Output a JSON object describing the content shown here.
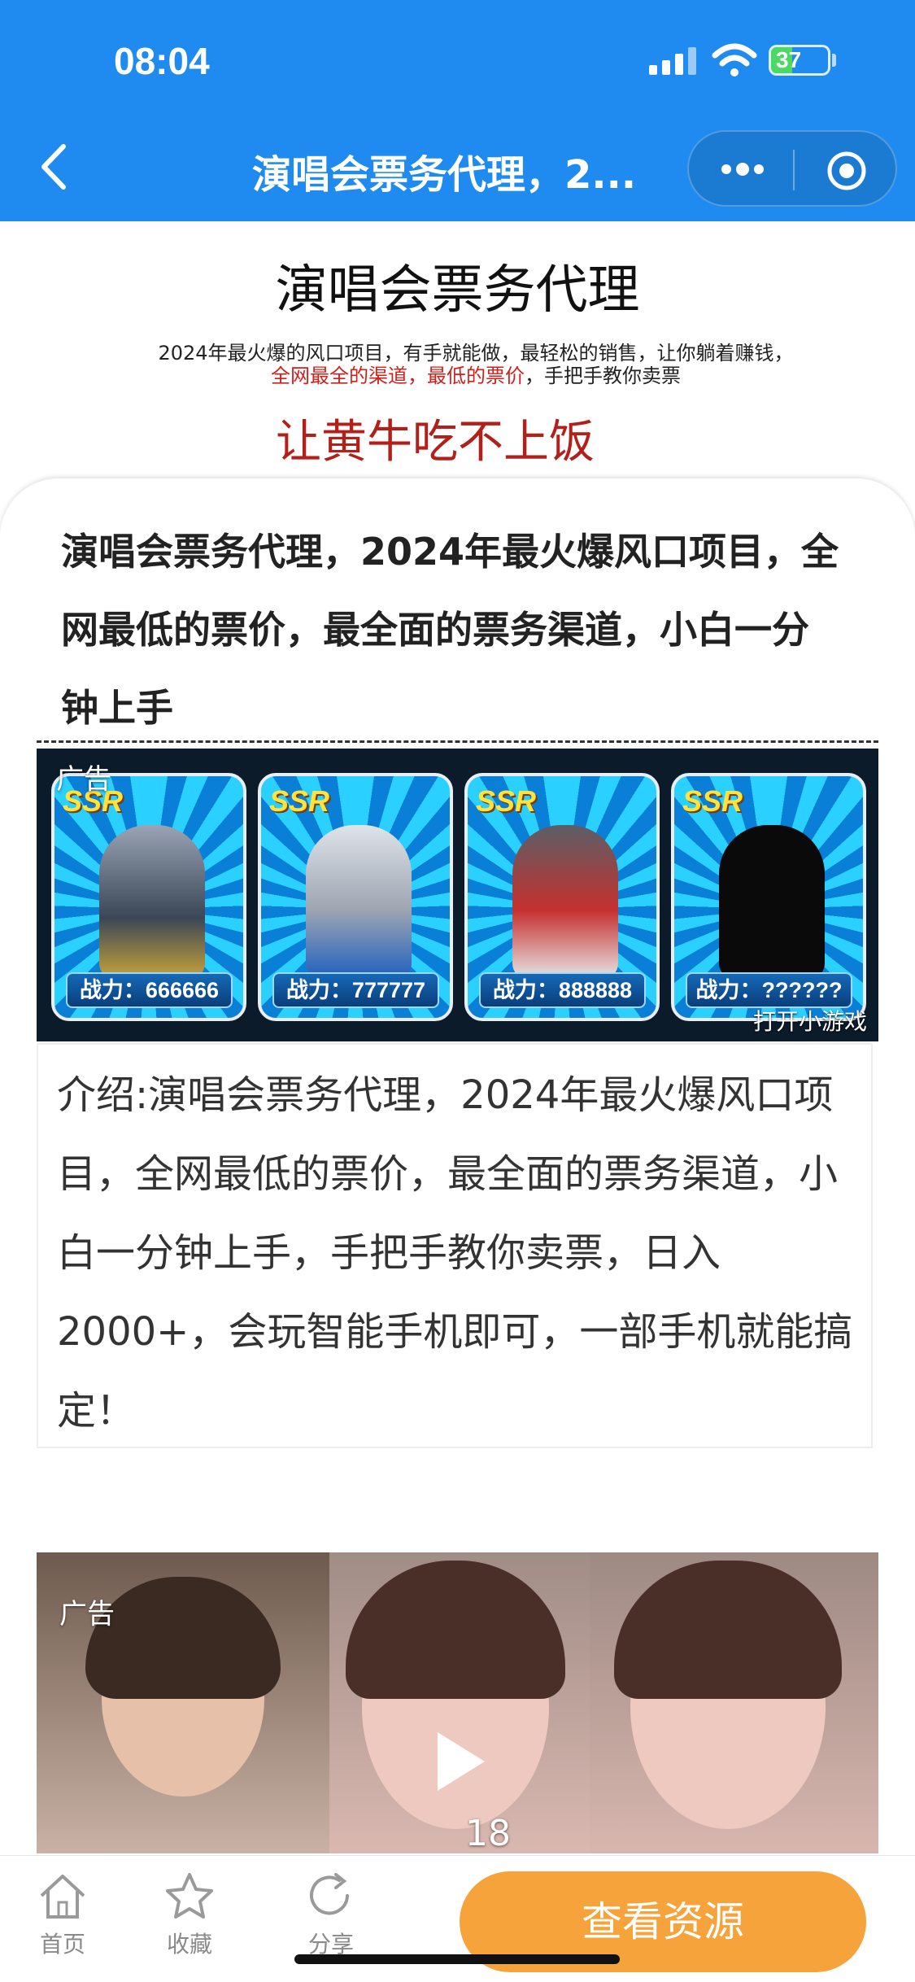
{
  "status_bar": {
    "time": "08:04",
    "battery": "37",
    "battery_level": 0.37
  },
  "nav": {
    "title": "演唱会票务代理，2...",
    "back_icon": "chevron-left-icon",
    "more_icon": "more-dots-icon",
    "close_icon": "target-circle-icon"
  },
  "poster": {
    "title": "演唱会票务代理",
    "subtitle_part1": "2024年最火爆的风口项目，有手就能做，最轻松的销售，让你躺着赚钱，",
    "subtitle_red": "全网最全的渠道，最低的票价",
    "subtitle_part3": "，手把手教你卖票",
    "red_slogan": "让黄牛吃不上饭"
  },
  "article": {
    "title": "演唱会票务代理，2024年最火爆风口项目，全网最低的票价，最全面的票务渠道，小白一分钟上手"
  },
  "game_ad": {
    "tag": "广告",
    "badge": "SSR",
    "cards": [
      {
        "power": "战力：666666",
        "color": "#c9a53a"
      },
      {
        "power": "战力：777777",
        "color": "#c8ccd4"
      },
      {
        "power": "战力：888888",
        "color": "#c4312f"
      },
      {
        "power": "战力：??????",
        "color": "#0a0a0a"
      }
    ],
    "open_label": "打开小游戏"
  },
  "intro": {
    "text": "介绍:演唱会票务代理，2024年最火爆风口项目，全网最低的票价，最全面的票务渠道，小白一分钟上手，手把手教你卖票，日入2000+，会玩智能手机即可，一部手机就能搞定！"
  },
  "video_ad": {
    "tag": "广告",
    "count": "18"
  },
  "tabbar": {
    "items": [
      {
        "label": "首页",
        "icon": "home-icon"
      },
      {
        "label": "收藏",
        "icon": "star-icon"
      },
      {
        "label": "分享",
        "icon": "share-icon"
      }
    ],
    "cta": "查看资源"
  }
}
